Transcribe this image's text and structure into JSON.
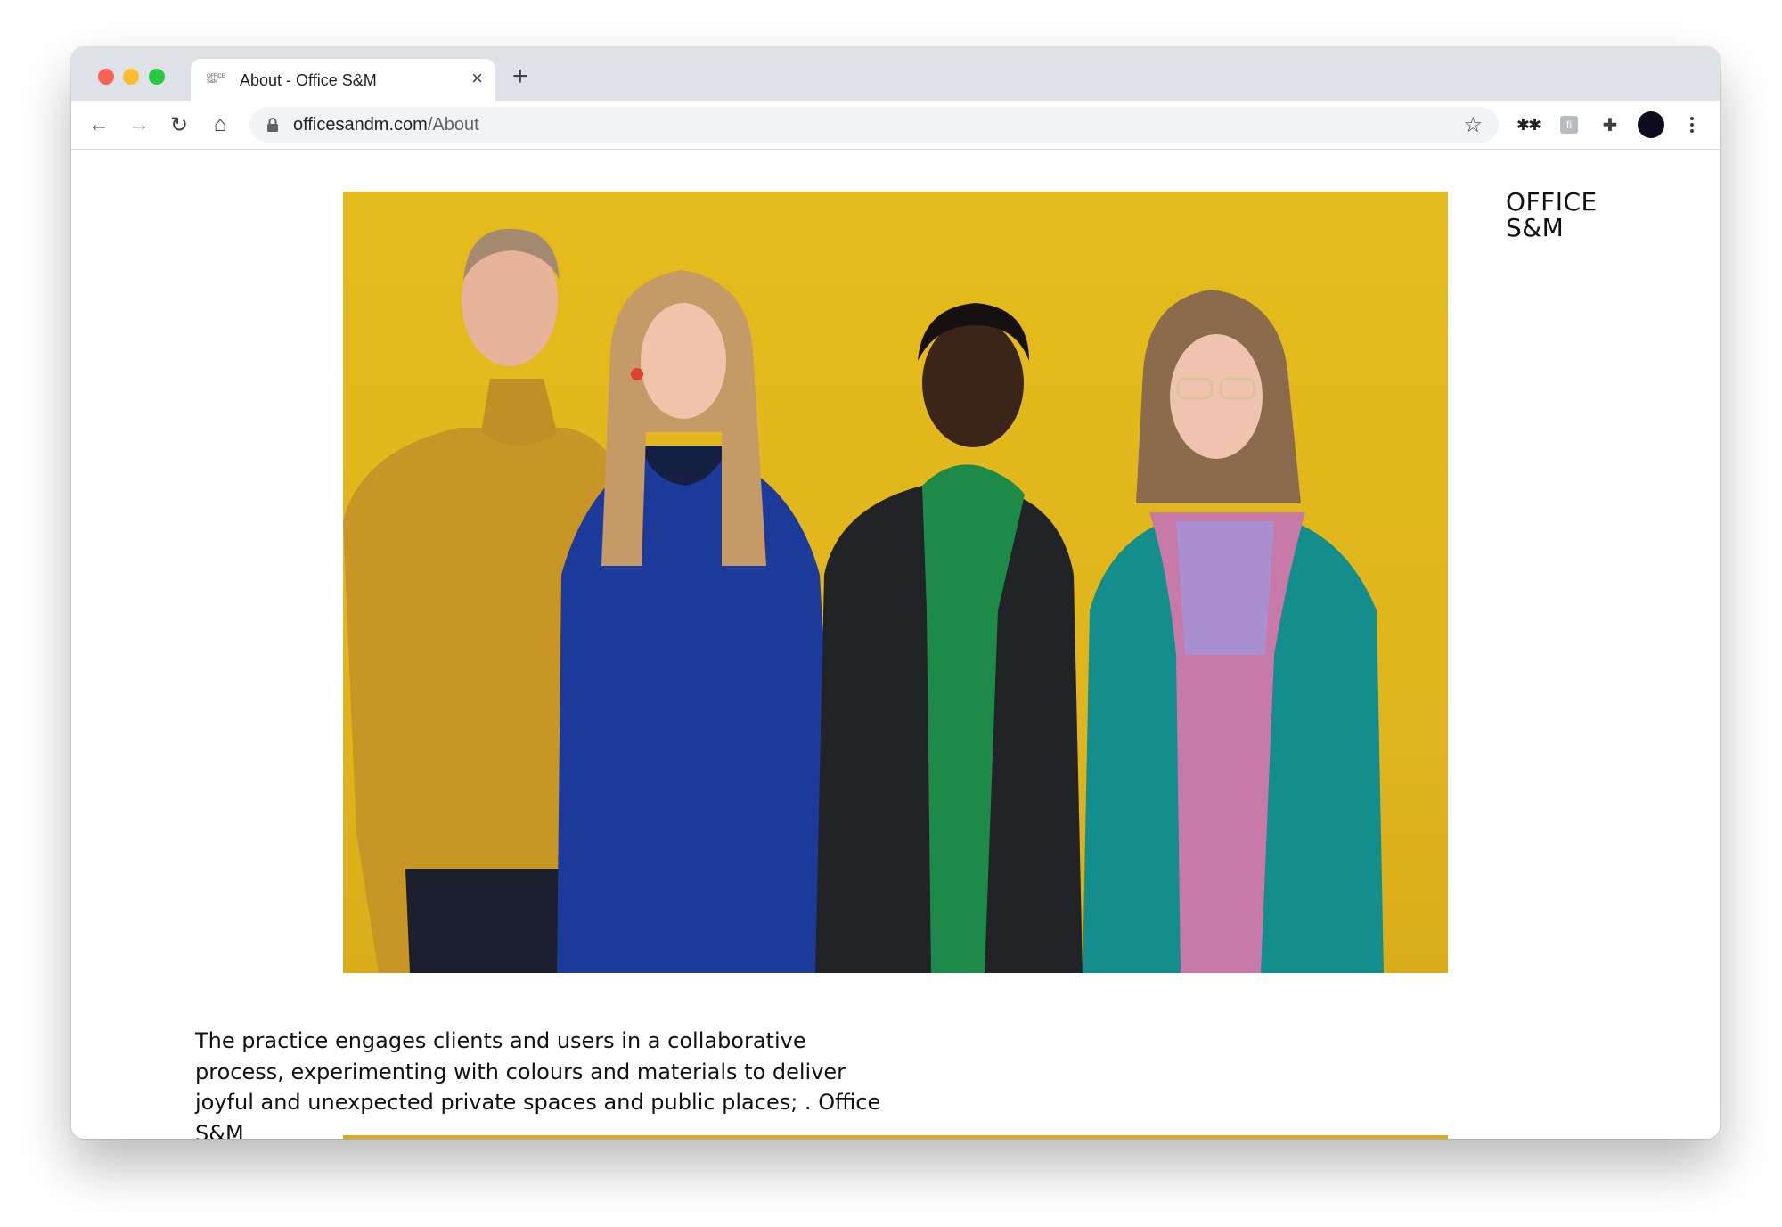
{
  "browser": {
    "tab": {
      "favicon_text": "OFFICE S&M",
      "title": "About - Office S&M",
      "close_label": "×"
    },
    "new_tab_label": "+",
    "nav": {
      "back": "←",
      "forward": "→",
      "reload": "↻",
      "home": "⌂"
    },
    "address": {
      "host": "officesandm.com",
      "path": "/About"
    },
    "star_label": "☆",
    "extensions": {
      "asterisk": "✱✱",
      "box": "fi",
      "puzzle": "✚"
    }
  },
  "site": {
    "logo": {
      "line1": "OFFICE",
      "line2": "S&M"
    },
    "hero_image_alt": "Four team members of Office S&M standing in front of a yellow wall",
    "intro_text": "The practice engages clients and users in a collaborative process, experimenting with colours and materials to deliver joyful and unexpected private spaces and public places; . Office S&M"
  },
  "colors": {
    "hero_background": "#e4bb1c",
    "traffic_red": "#fe5f57",
    "traffic_yellow": "#febc2e",
    "traffic_green": "#28c840"
  }
}
